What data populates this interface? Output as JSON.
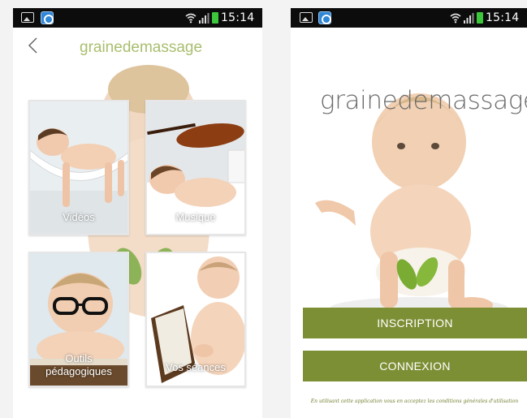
{
  "statusbar": {
    "time": "15:14"
  },
  "left_screen": {
    "brand": "grainedemassage",
    "tiles": [
      {
        "label": "Vidéos"
      },
      {
        "label": "Musique"
      },
      {
        "label": "Outils\npédagogiques"
      },
      {
        "label": "Vos séances"
      }
    ]
  },
  "right_screen": {
    "brand": "grainedemassage",
    "inscription_label": "INSCRIPTION",
    "connexion_label": "CONNEXION",
    "terms_text": "En utilisant cette application vous en acceptez les conditions générales d'utilisation"
  },
  "icons": [
    "image-icon",
    "app-icon",
    "wifi-icon",
    "signal-icon",
    "battery-icon",
    "back-icon"
  ],
  "colors": {
    "brand_green": "#a9be6e",
    "button_green": "#7d8f35",
    "statusbar": "#0c0c0c"
  }
}
